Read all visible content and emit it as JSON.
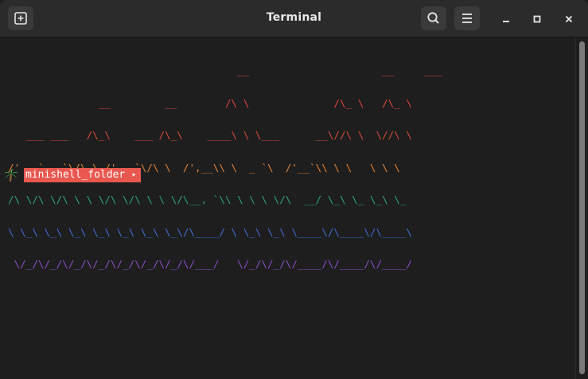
{
  "window": {
    "title": "Terminal",
    "new_tab_icon": "new-tab-icon",
    "search_icon": "search-icon",
    "menu_icon": "hamburger-menu-icon",
    "minimize_icon": "minimize-icon",
    "maximize_icon": "maximize-icon",
    "close_icon": "close-icon"
  },
  "banner": {
    "lines": [
      {
        "text": "                                      __                      __     ___",
        "color": "#e74c3c"
      },
      {
        "text": "               __         __        /\\ \\              /\\_ \\   /\\_ \\",
        "color": "#e0463c"
      },
      {
        "text": "   ___ ___   /\\_\\    ___ /\\_\\    ____\\ \\ \\___      __\\//\\ \\  \\//\\ \\",
        "color": "#d84a3a"
      },
      {
        "text": "/' __` __`\\/\\ \\ /' _ `\\/\\ \\  /',__\\\\ \\  _ `\\  /'__`\\\\ \\ \\   \\ \\ \\",
        "color": "#e0823a"
      },
      {
        "text": "/\\ \\/\\ \\/\\ \\ \\ \\/\\ \\/\\ \\ \\ \\/\\__, `\\\\ \\ \\ \\ \\/\\  __/ \\_\\ \\_ \\_\\ \\_",
        "color": "#2fa37a"
      },
      {
        "text": "\\ \\_\\ \\_\\ \\_\\ \\_\\ \\_\\ \\_\\ \\_\\/\\____/ \\ \\_\\ \\_\\ \\____\\/\\____\\/\\____\\",
        "color": "#3d6fd6"
      },
      {
        "text": " \\/_/\\/_/\\/_/\\/_/\\/_/\\/_/\\/_/\\/___/   \\/_/\\/_/\\/____/\\/____/\\/____/",
        "color": "#8a4fc8"
      }
    ]
  },
  "prompt": {
    "icon": "palm-tree-icon",
    "folder": "minishell_folder",
    "arrow": "➤",
    "bg_color": "#e8584f"
  }
}
